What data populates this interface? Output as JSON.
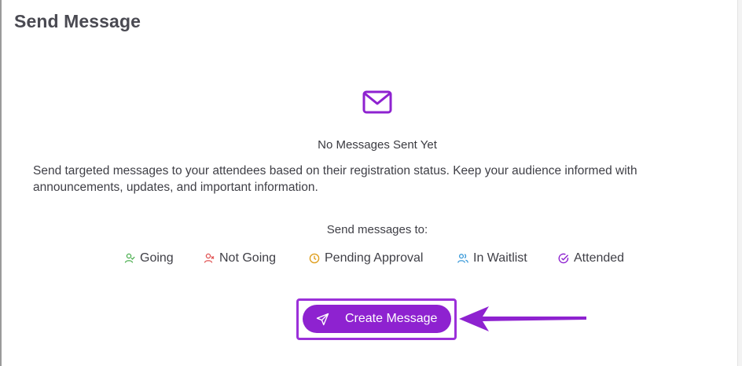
{
  "header": {
    "title": "Send Message"
  },
  "empty_state": {
    "icon": "mail-icon",
    "title": "No Messages Sent Yet",
    "description": "Send targeted messages to your attendees based on their registration status. Keep your audience informed with announcements, updates, and important information."
  },
  "audience": {
    "label": "Send messages to:",
    "statuses": [
      {
        "label": "Going",
        "icon": "user-check-icon",
        "color": "#4caf50"
      },
      {
        "label": "Not Going",
        "icon": "user-x-icon",
        "color": "#e05252"
      },
      {
        "label": "Pending Approval",
        "icon": "clock-icon",
        "color": "#e0a020"
      },
      {
        "label": "In Waitlist",
        "icon": "users-icon",
        "color": "#3b9ad9"
      },
      {
        "label": "Attended",
        "icon": "check-circle-icon",
        "color": "#8e22d0"
      }
    ]
  },
  "actions": {
    "create_message_label": "Create Message",
    "create_message_icon": "send-icon"
  },
  "colors": {
    "accent": "#8e22d0",
    "highlight_frame": "#9b30d9",
    "arrow": "#8e22d0"
  }
}
